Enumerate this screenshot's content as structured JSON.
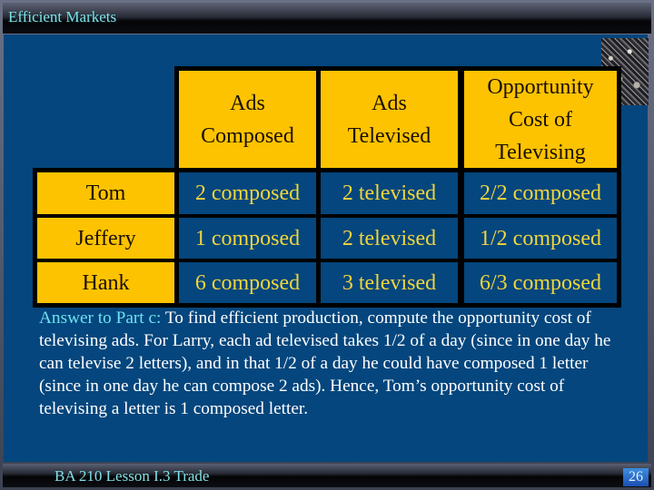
{
  "slide": {
    "title": "Efficient Markets",
    "footer": "BA 210  Lesson I.3 Trade",
    "page_number": "26",
    "photo_icon": "crowd-photo"
  },
  "table": {
    "headers": [
      "Ads Composed",
      "Ads Televised",
      "Opportunity Cost of Televising"
    ],
    "header_lines": [
      [
        "Ads",
        "Composed"
      ],
      [
        "Ads",
        "Televised"
      ],
      [
        "Opportunity",
        "Cost of",
        "Televising"
      ]
    ],
    "rows": [
      {
        "name": "Tom",
        "composed": "2 composed",
        "televised": "2 televised",
        "opp_cost": "2/2 composed"
      },
      {
        "name": "Jeffery",
        "composed": "1 composed",
        "televised": "2 televised",
        "opp_cost": "1/2 composed"
      },
      {
        "name": "Hank",
        "composed": "6 composed",
        "televised": "3 televised",
        "opp_cost": "6/3 composed"
      }
    ]
  },
  "answer": {
    "lead": "Answer to Part c:",
    "text": " To find efficient production, compute the opportunity cost of televising ads. For Larry, each ad televised takes 1/2 of a day (since in one day he can televise 2 letters), and in that 1/2 of a day he could have composed 1 letter (since in one day he can compose 2 ads). Hence, Tom’s opportunity cost of televising a letter is 1 composed letter."
  },
  "colors": {
    "background": "#04467d",
    "cell_yellow": "#fdc300",
    "value_text": "#f2d53b",
    "title_text": "#7fe0e6"
  }
}
